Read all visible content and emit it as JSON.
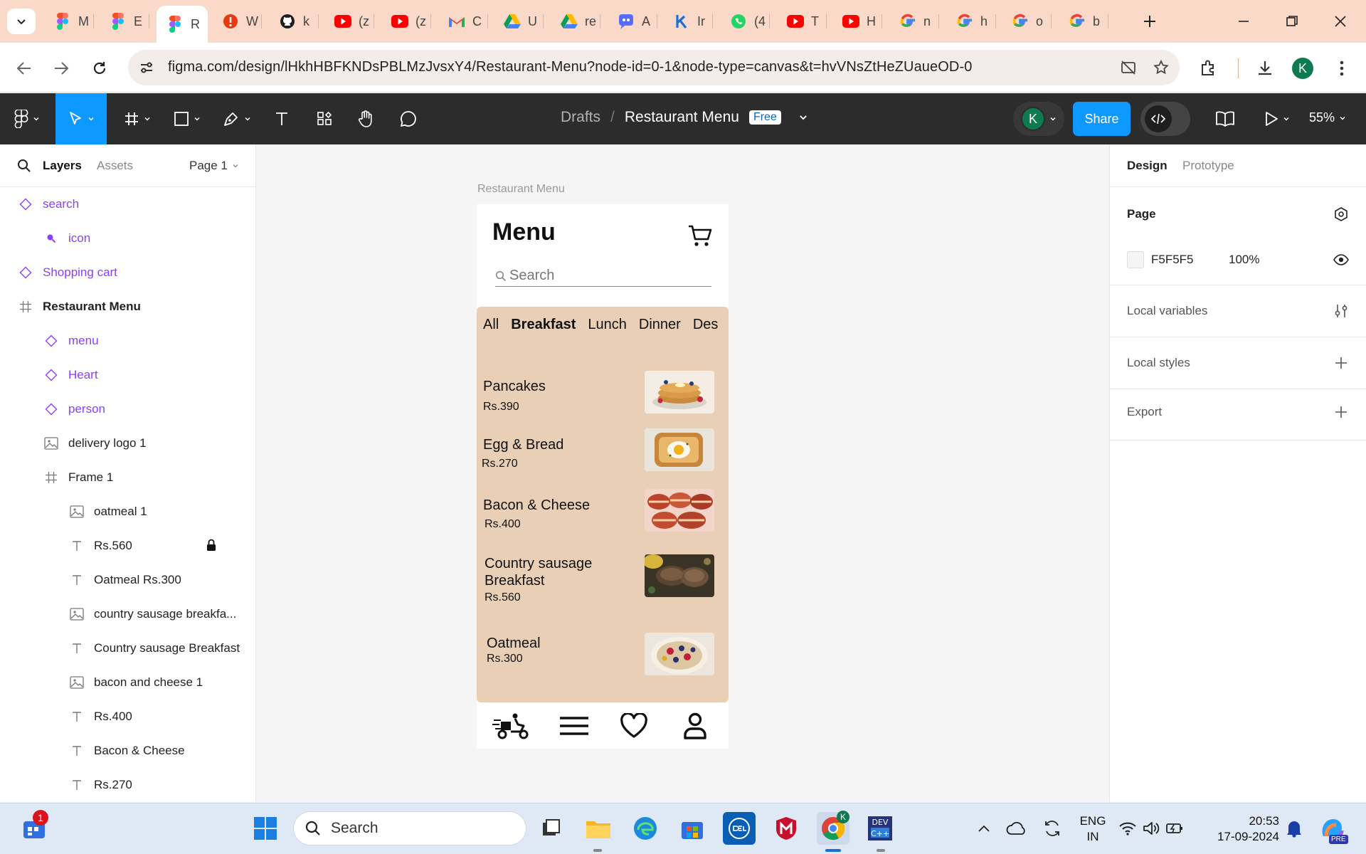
{
  "browser": {
    "tabs": [
      {
        "letter": "M",
        "icon": "figma-icon"
      },
      {
        "letter": "E",
        "icon": "figma-icon"
      },
      {
        "letter": "R",
        "icon": "figma-icon",
        "active": true
      },
      {
        "letter": "W",
        "icon": "alert-icon"
      },
      {
        "letter": "k",
        "icon": "github-icon"
      },
      {
        "letter": "(z",
        "icon": "youtube-icon"
      },
      {
        "letter": "(z",
        "icon": "youtube-icon"
      },
      {
        "letter": "C",
        "icon": "gmail-icon"
      },
      {
        "letter": "U",
        "icon": "drive-icon"
      },
      {
        "letter": "re",
        "icon": "drive-icon"
      },
      {
        "letter": "A",
        "icon": "chat-icon"
      },
      {
        "letter": "Ir",
        "icon": "k-icon"
      },
      {
        "letter": "(4",
        "icon": "whatsapp-icon"
      },
      {
        "letter": "T",
        "icon": "youtube-icon"
      },
      {
        "letter": "H",
        "icon": "youtube-icon"
      },
      {
        "letter": "n",
        "icon": "google-icon"
      },
      {
        "letter": "h",
        "icon": "google-icon"
      },
      {
        "letter": "o",
        "icon": "google-icon"
      },
      {
        "letter": "b",
        "icon": "google-icon"
      }
    ],
    "url": "figma.com/design/lHkhHBFKNDsPBLMzJvsxY4/Restaurant-Menu?node-id=0-1&node-type=canvas&t=hvVNsZtHeZUaueOD-0",
    "profile_letter": "K",
    "colors": {
      "tabbar": "#fad9c8",
      "omnibox": "#f3ece8"
    }
  },
  "figma": {
    "breadcrumb_drafts": "Drafts",
    "breadcrumb_sep": "/",
    "file_name": "Restaurant Menu",
    "plan_badge": "Free",
    "avatar_letter": "K",
    "share_label": "Share",
    "zoom": "55%",
    "colors": {
      "toolbar": "#2c2c2c",
      "accent": "#0d99ff",
      "component": "#8a3ffc"
    }
  },
  "left_panel": {
    "tab_layers": "Layers",
    "tab_assets": "Assets",
    "page_select": "Page 1",
    "layers": [
      {
        "name": "search",
        "type": "component",
        "indent": 0
      },
      {
        "name": "icon",
        "type": "search-glyph",
        "indent": 1
      },
      {
        "name": "Shopping cart",
        "type": "component",
        "indent": 0
      },
      {
        "name": "Restaurant Menu",
        "type": "frame",
        "indent": 0
      },
      {
        "name": "menu",
        "type": "component",
        "indent": 1
      },
      {
        "name": "Heart",
        "type": "component",
        "indent": 1
      },
      {
        "name": "person",
        "type": "component",
        "indent": 1
      },
      {
        "name": "delivery logo 1",
        "type": "image",
        "indent": 1
      },
      {
        "name": "Frame 1",
        "type": "frame",
        "indent": 1
      },
      {
        "name": "oatmeal 1",
        "type": "image",
        "indent": 2
      },
      {
        "name": "Rs.560",
        "type": "text",
        "indent": 2,
        "locked": true
      },
      {
        "name": "Oatmeal Rs.300",
        "type": "text",
        "indent": 2
      },
      {
        "name": "country sausage breakfa...",
        "type": "image",
        "indent": 2
      },
      {
        "name": "Country sausage Breakfast",
        "type": "text",
        "indent": 2
      },
      {
        "name": "bacon and cheese 1",
        "type": "image",
        "indent": 2
      },
      {
        "name": "Rs.400",
        "type": "text",
        "indent": 2
      },
      {
        "name": "Bacon & Cheese",
        "type": "text",
        "indent": 2
      },
      {
        "name": "Rs.270",
        "type": "text",
        "indent": 2
      }
    ]
  },
  "canvas": {
    "frame_label": "Restaurant Menu",
    "app": {
      "title": "Menu",
      "search_placeholder": "Search",
      "categories": [
        {
          "label": "All",
          "selected": false
        },
        {
          "label": "Breakfast",
          "selected": true
        },
        {
          "label": "Lunch",
          "selected": false
        },
        {
          "label": "Dinner",
          "selected": false
        },
        {
          "label": "Des",
          "selected": false
        }
      ],
      "items": [
        {
          "name": "Pancakes",
          "price": "Rs.390",
          "image": "pancakes-image"
        },
        {
          "name": "Egg & Bread",
          "price": "Rs.270",
          "image": "egg-bread-image"
        },
        {
          "name": "Bacon & Cheese",
          "price": "Rs.400",
          "image": "bacon-cheese-image"
        },
        {
          "name": "Country sausage\nBreakfast",
          "price": "Rs.560",
          "image": "sausage-breakfast-image"
        },
        {
          "name": "Oatmeal",
          "price": "Rs.300",
          "image": "oatmeal-image"
        }
      ],
      "bottom_nav": [
        "delivery-icon",
        "menu-icon",
        "heart-icon",
        "person-icon"
      ],
      "colors": {
        "card": "#e8cfb5"
      }
    },
    "help_label": "?"
  },
  "right_panel": {
    "tab_design": "Design",
    "tab_prototype": "Prototype",
    "page_heading": "Page",
    "page_color": "F5F5F5",
    "page_opacity": "100%",
    "local_variables": "Local variables",
    "local_styles": "Local styles",
    "export": "Export"
  },
  "taskbar": {
    "search_placeholder": "Search",
    "notification_count": "1",
    "lang_top": "ENG",
    "lang_bottom": "IN",
    "time": "20:53",
    "date": "17-09-2024",
    "copilot_badge": "PRE"
  }
}
